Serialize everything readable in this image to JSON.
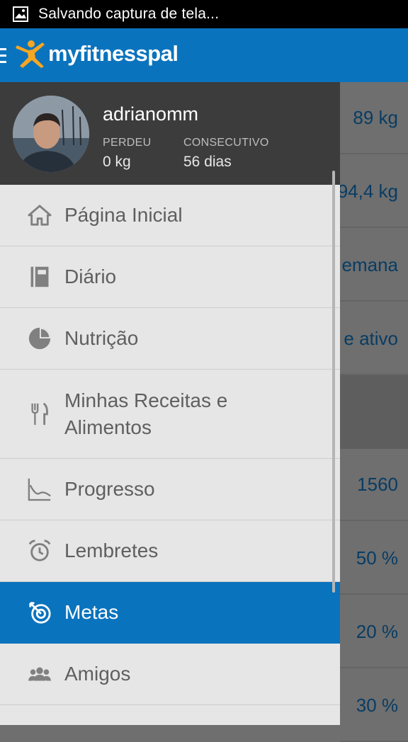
{
  "status_bar": {
    "notification_text": "Salvando captura de tela..."
  },
  "app_bar": {
    "brand": "myfitnesspal"
  },
  "profile": {
    "username": "adrianomm",
    "stats": [
      {
        "label": "PERDEU",
        "value": "0 kg"
      },
      {
        "label": "CONSECUTIVO",
        "value": "56 dias"
      }
    ]
  },
  "menu": {
    "items": [
      {
        "label": "Página Inicial",
        "icon": "home-icon"
      },
      {
        "label": "Diário",
        "icon": "diary-icon"
      },
      {
        "label": "Nutrição",
        "icon": "pie-chart-icon"
      },
      {
        "label": "Minhas Receitas e Alimentos",
        "icon": "utensils-icon"
      },
      {
        "label": "Progresso",
        "icon": "chart-icon"
      },
      {
        "label": "Lembretes",
        "icon": "alarm-clock-icon"
      },
      {
        "label": "Metas",
        "icon": "target-icon",
        "active": true
      },
      {
        "label": "Amigos",
        "icon": "friends-icon"
      }
    ]
  },
  "background_values": [
    "89 kg",
    "94,4 kg",
    "emana",
    "e ativo",
    "1560",
    "50 %",
    "20 %",
    "30 %"
  ],
  "colors": {
    "accent": "#0a73bd",
    "drawer_bg": "#e6e6e6",
    "profile_bg": "#3c3c3c"
  }
}
